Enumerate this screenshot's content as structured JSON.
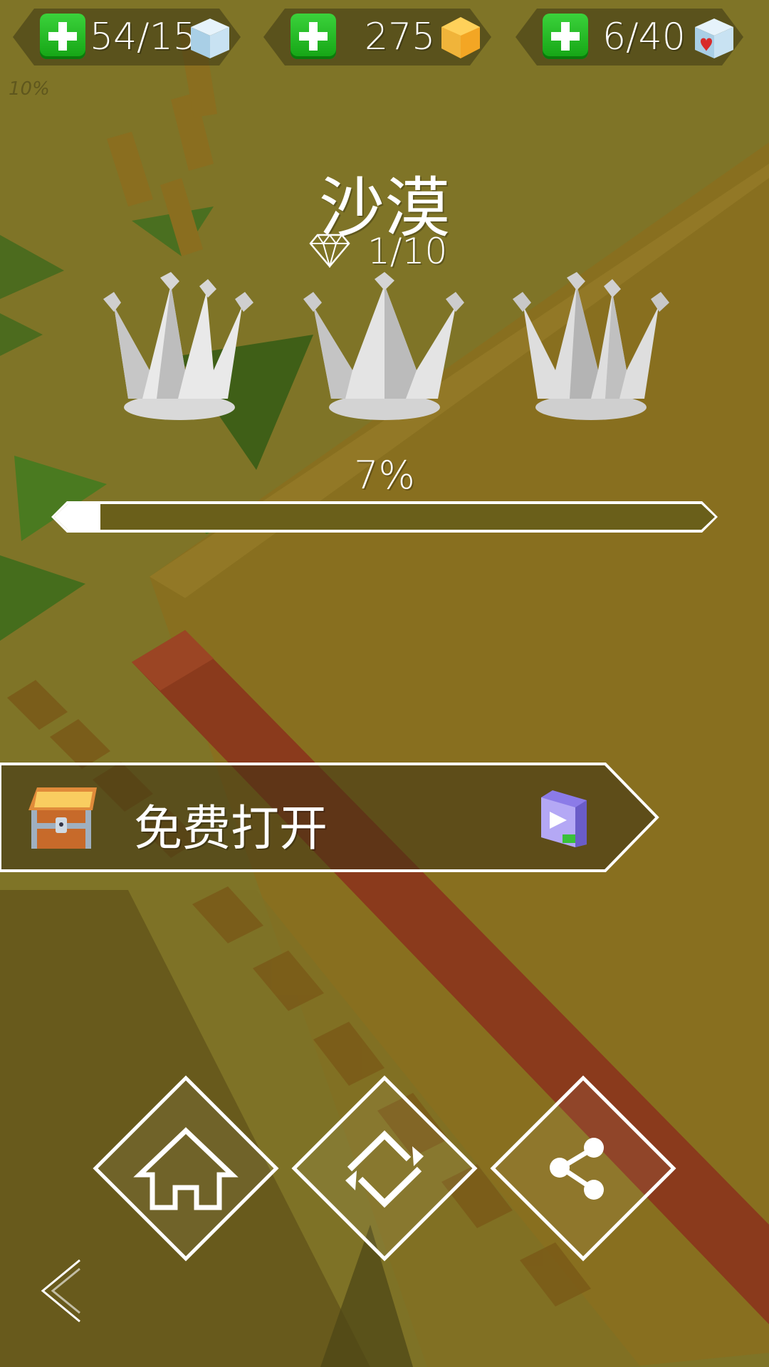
{
  "hud": {
    "cubes": {
      "value": "54/15",
      "icon": "ice-cube-icon"
    },
    "gems": {
      "value": "275",
      "icon": "gold-gem-icon"
    },
    "lives": {
      "value": "6/40",
      "icon": "heart-cube-icon"
    }
  },
  "corner_progress": "10%",
  "level": {
    "title": "沙漠",
    "diamonds": "1/10",
    "crowns_earned": 0,
    "crowns_total": 3,
    "progress_text": "7%",
    "progress_fraction": 0.07
  },
  "chest_button": {
    "label": "免费打开",
    "icon": "treasure-chest-icon",
    "ad_icon": "video-ad-icon"
  },
  "actions": [
    {
      "name": "home-button",
      "icon": "home-icon"
    },
    {
      "name": "restart-button",
      "icon": "restart-icon"
    },
    {
      "name": "share-button",
      "icon": "share-icon"
    }
  ],
  "back_icon": "chevron-left-icon",
  "colors": {
    "background": "#7f7427",
    "wall": "#8a6a1e",
    "red_path": "#8a3a1c",
    "plus_green": "#22b422",
    "gold": "#f5b82e"
  }
}
